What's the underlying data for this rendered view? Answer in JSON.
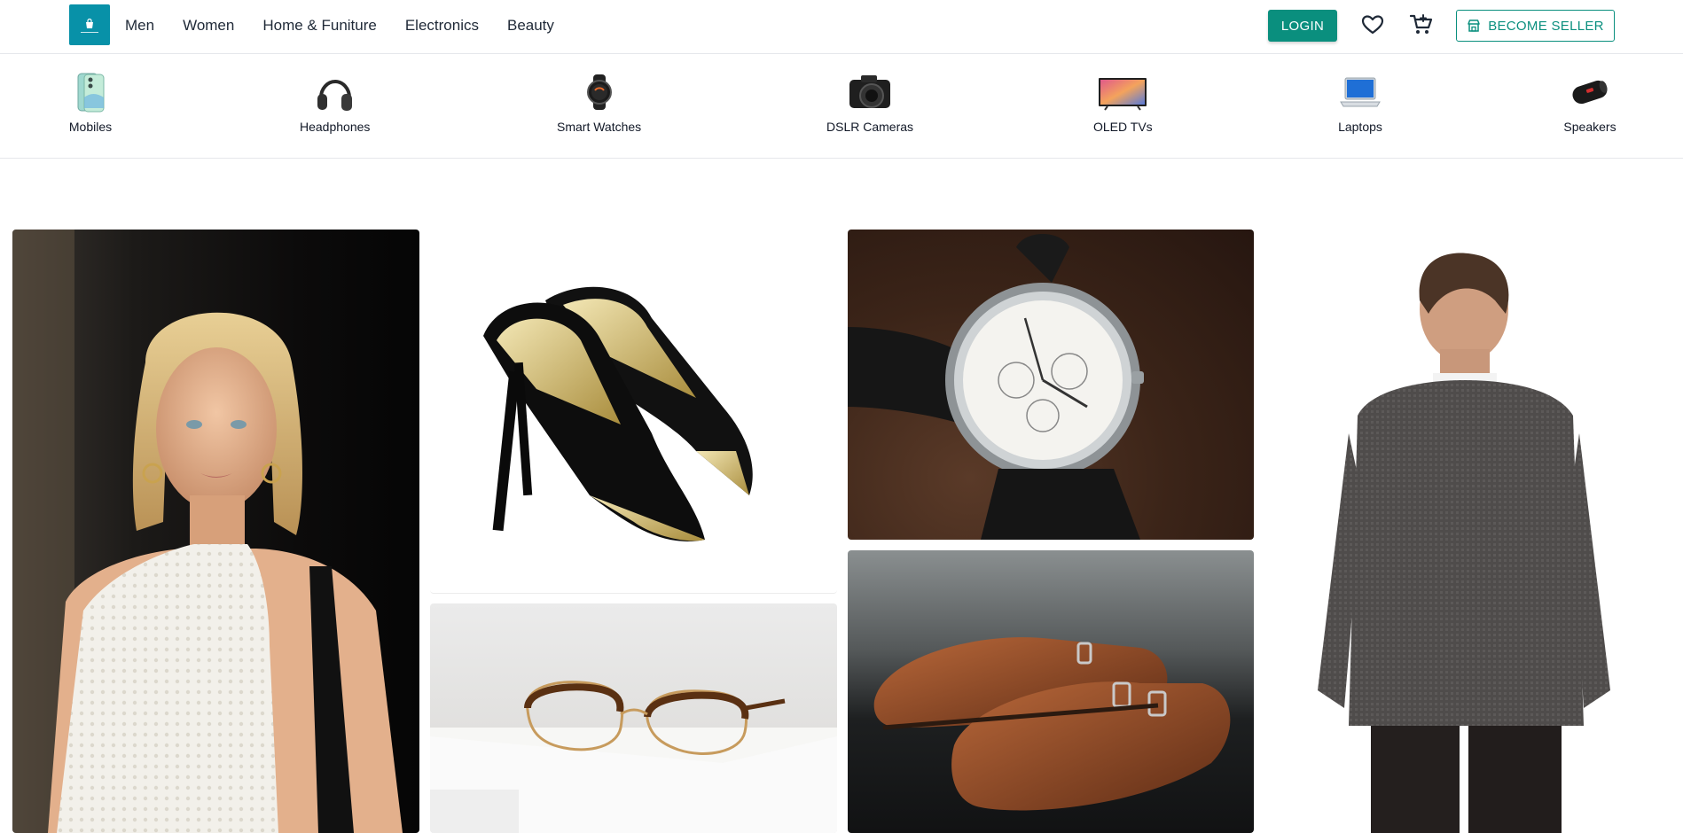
{
  "brand": {
    "logo_icon": "store-bag-icon"
  },
  "nav": {
    "links": [
      "Men",
      "Women",
      "Home & Funiture",
      "Electronics",
      "Beauty"
    ],
    "login_label": "LOGIN",
    "seller_label": "BECOME SELLER"
  },
  "categories": [
    {
      "label": "Mobiles",
      "icon": "phone-icon"
    },
    {
      "label": "Headphones",
      "icon": "headphones-icon"
    },
    {
      "label": "Smart Watches",
      "icon": "smartwatch-icon"
    },
    {
      "label": "DSLR Cameras",
      "icon": "camera-icon"
    },
    {
      "label": "OLED TVs",
      "icon": "tv-icon"
    },
    {
      "label": "Laptops",
      "icon": "laptop-icon"
    },
    {
      "label": "Speakers",
      "icon": "speaker-icon"
    }
  ],
  "colors": {
    "accent": "#0a8f7e",
    "logo_bg": "#0891a8",
    "text": "#1f2937"
  }
}
